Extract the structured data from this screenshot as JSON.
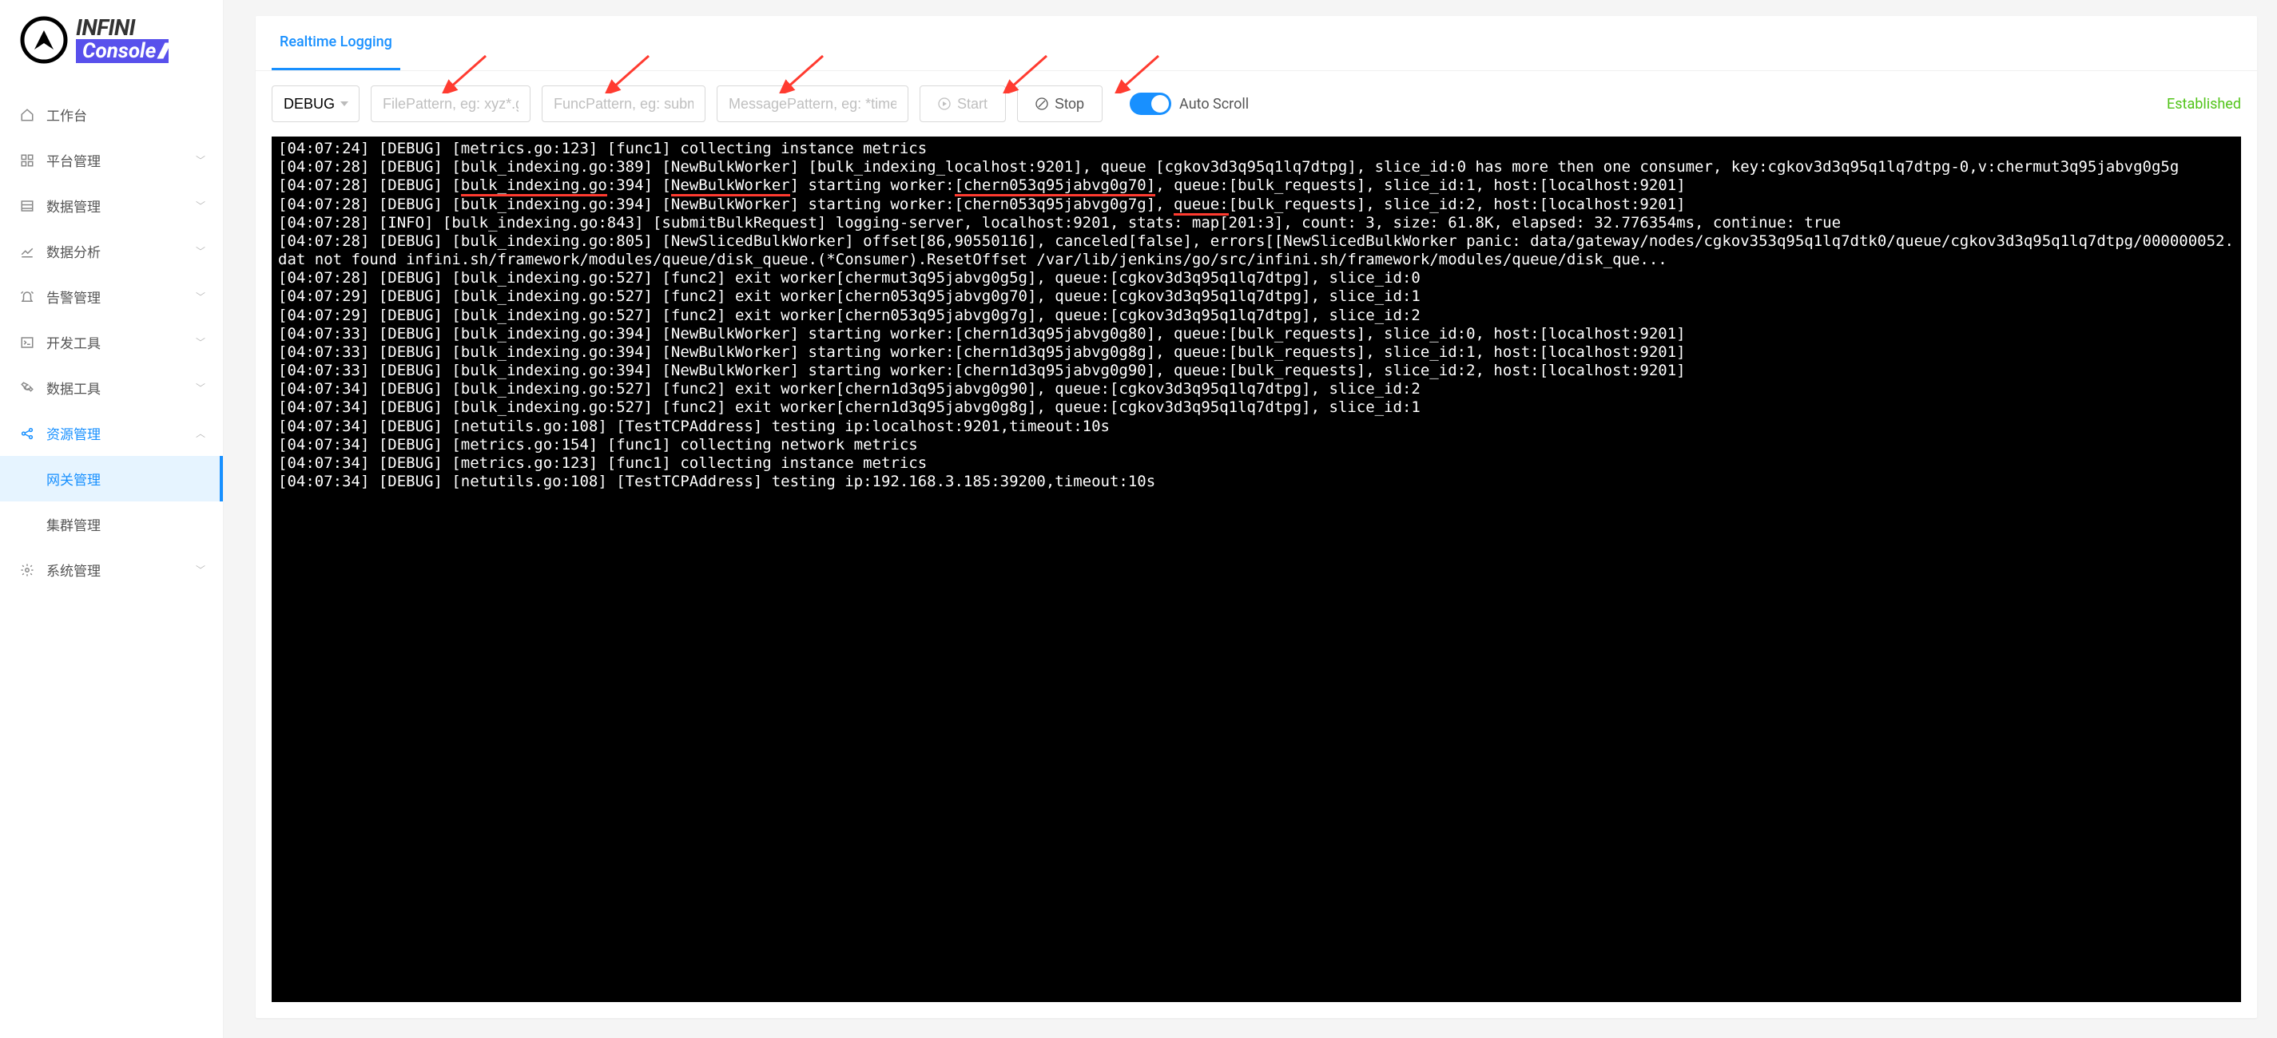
{
  "brand": {
    "line1": "INFINI",
    "line2": "Console"
  },
  "sidebar": {
    "items": [
      {
        "label": "工作台",
        "icon": "home"
      },
      {
        "label": "平台管理",
        "icon": "grid"
      },
      {
        "label": "数据管理",
        "icon": "list"
      },
      {
        "label": "数据分析",
        "icon": "chart"
      },
      {
        "label": "告警管理",
        "icon": "alert"
      },
      {
        "label": "开发工具",
        "icon": "terminal"
      },
      {
        "label": "数据工具",
        "icon": "wrench"
      },
      {
        "label": "资源管理",
        "icon": "share",
        "active": true,
        "expanded": true,
        "children": [
          {
            "label": "网关管理",
            "active": true
          },
          {
            "label": "集群管理"
          }
        ]
      },
      {
        "label": "系统管理",
        "icon": "gear"
      }
    ]
  },
  "tabs": {
    "active": "Realtime Logging"
  },
  "toolbar": {
    "level": "DEBUG",
    "file_placeholder": "FilePattern, eg: xyz*.go",
    "func_placeholder": "FuncPattern, eg: submit*",
    "msg_placeholder": "MessagePattern, eg: *timeout",
    "start_label": "Start",
    "stop_label": "Stop",
    "auto_scroll_label": "Auto Scroll",
    "status": "Established"
  },
  "logs": [
    "[04:07:24] [DEBUG] [metrics.go:123] [func1] collecting instance metrics",
    "[04:07:28] [DEBUG] [bulk_indexing.go:389] [NewBulkWorker] [bulk_indexing_localhost:9201], queue [cgkov3d3q95q1lq7dtpg], slice_id:0 has more then one consumer, key:cgkov3d3q95q1lq7dtpg-0,v:chermut3q95jabvg0g5g",
    "[04:07:28] [DEBUG] [bulk_indexing.go:394] [NewBulkWorker] starting worker:[chern053q95jabvg0g70], queue:[bulk_requests], slice_id:1, host:[localhost:9201]",
    "[04:07:28] [DEBUG] [bulk_indexing.go:394] [NewBulkWorker] starting worker:[chern053q95jabvg0g7g], queue:[bulk_requests], slice_id:2, host:[localhost:9201]",
    "[04:07:28] [INFO] [bulk_indexing.go:843] [submitBulkRequest] logging-server, localhost:9201, stats: map[201:3], count: 3, size: 61.8K, elapsed: 32.776354ms, continue: true",
    "[04:07:28] [DEBUG] [bulk_indexing.go:805] [NewSlicedBulkWorker] offset[86,90550116], canceled[false], errors[[NewSlicedBulkWorker panic: data/gateway/nodes/cgkov353q95q1lq7dtk0/queue/cgkov3d3q95q1lq7dtpg/000000052.dat not found infini.sh/framework/modules/queue/disk_queue.(*Consumer).ResetOffset /var/lib/jenkins/go/src/infini.sh/framework/modules/queue/disk_que...",
    "[04:07:28] [DEBUG] [bulk_indexing.go:527] [func2] exit worker[chermut3q95jabvg0g5g], queue:[cgkov3d3q95q1lq7dtpg], slice_id:0",
    "[04:07:29] [DEBUG] [bulk_indexing.go:527] [func2] exit worker[chern053q95jabvg0g70], queue:[cgkov3d3q95q1lq7dtpg], slice_id:1",
    "[04:07:29] [DEBUG] [bulk_indexing.go:527] [func2] exit worker[chern053q95jabvg0g7g], queue:[cgkov3d3q95q1lq7dtpg], slice_id:2",
    "[04:07:33] [DEBUG] [bulk_indexing.go:394] [NewBulkWorker] starting worker:[chern1d3q95jabvg0g80], queue:[bulk_requests], slice_id:0, host:[localhost:9201]",
    "[04:07:33] [DEBUG] [bulk_indexing.go:394] [NewBulkWorker] starting worker:[chern1d3q95jabvg0g8g], queue:[bulk_requests], slice_id:1, host:[localhost:9201]",
    "[04:07:33] [DEBUG] [bulk_indexing.go:394] [NewBulkWorker] starting worker:[chern1d3q95jabvg0g90], queue:[bulk_requests], slice_id:2, host:[localhost:9201]",
    "[04:07:34] [DEBUG] [bulk_indexing.go:527] [func2] exit worker[chern1d3q95jabvg0g90], queue:[cgkov3d3q95q1lq7dtpg], slice_id:2",
    "[04:07:34] [DEBUG] [bulk_indexing.go:527] [func2] exit worker[chern1d3q95jabvg0g8g], queue:[cgkov3d3q95q1lq7dtpg], slice_id:1",
    "[04:07:34] [DEBUG] [netutils.go:108] [TestTCPAddress] testing ip:localhost:9201,timeout:10s",
    "[04:07:34] [DEBUG] [metrics.go:154] [func1] collecting network metrics",
    "[04:07:34] [DEBUG] [metrics.go:123] [func1] collecting instance metrics",
    "[04:07:34] [DEBUG] [netutils.go:108] [TestTCPAddress] testing ip:192.168.3.185:39200,timeout:10s"
  ],
  "annotations": {
    "underlines": [
      {
        "line": 2,
        "parts": [
          "bulk_indexing.go",
          "NewBulkWorker",
          "[chern053q95jabvg0g70]"
        ]
      },
      {
        "line": 3,
        "parts": [
          "queue:"
        ]
      }
    ]
  }
}
